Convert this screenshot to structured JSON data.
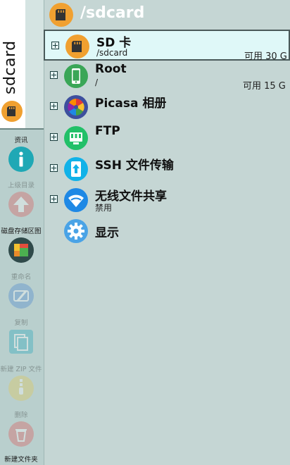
{
  "header": {
    "path": "/sdcard"
  },
  "tab": {
    "title": "sdcard"
  },
  "tools": [
    {
      "label": "资讯",
      "enabled": true
    },
    {
      "label": "上级目录",
      "enabled": false
    },
    {
      "label": "磁盘存储区图",
      "enabled": true
    },
    {
      "label": "重命名",
      "enabled": false
    },
    {
      "label": "复制",
      "enabled": false
    },
    {
      "label": "新建 ZIP 文件",
      "enabled": false
    },
    {
      "label": "删除",
      "enabled": false
    },
    {
      "label": "新建文件夹",
      "enabled": true
    }
  ],
  "locations": [
    {
      "name": "SD 卡",
      "sub": "/sdcard",
      "free": "可用 30 G",
      "icon": "sdcard-icon",
      "selected": true
    },
    {
      "name": "Root",
      "sub": "/",
      "free": "可用 15 G",
      "icon": "phone-icon"
    },
    {
      "name": "Picasa 相册",
      "icon": "picasa-icon"
    },
    {
      "name": "FTP",
      "icon": "ftp-icon"
    },
    {
      "name": "SSH 文件传输",
      "icon": "ssh-icon"
    },
    {
      "name": "无线文件共享",
      "sub": "禁用",
      "icon": "wifi-icon"
    },
    {
      "name": "显示",
      "icon": "settings-icon"
    }
  ],
  "colors": {
    "background": "#c5d6d4",
    "selected_row": "#dff8f8",
    "sd_orange": "#f0a030",
    "root_green": "#3aa657",
    "ftp_green": "#22c068",
    "ssh_cyan": "#11b2e8",
    "wifi_blue": "#1e88e5",
    "settings_blue": "#4aa3e6"
  }
}
